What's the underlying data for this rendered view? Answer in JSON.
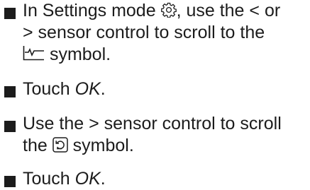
{
  "steps": [
    {
      "line1_before": "In Settings mode ",
      "icon1": "gear-icon",
      "line1_after": ", use the < or",
      "line2": "> sensor control to scroll to the",
      "icon2": "program-curve-icon",
      "line3_after": " symbol."
    },
    {
      "prefix": "Touch ",
      "emph": "OK",
      "suffix": "."
    },
    {
      "line1": "Use the > sensor control to scroll",
      "line2_before": "the ",
      "icon": "restore-arrow-icon",
      "line2_after": " symbol."
    },
    {
      "prefix": "Touch ",
      "emph": "OK",
      "suffix": "."
    }
  ],
  "colors": {
    "text": "#1c1c1c",
    "background": "#ffffff"
  }
}
